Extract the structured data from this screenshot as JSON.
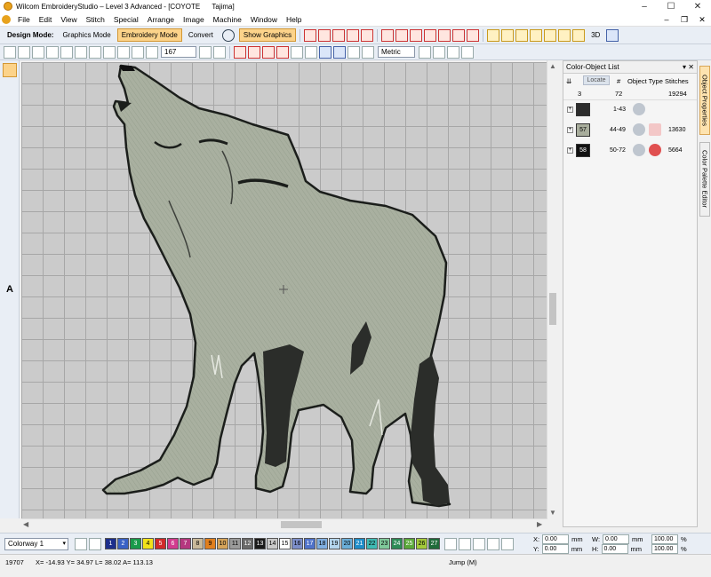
{
  "window": {
    "title": "Wilcom EmbroideryStudio – Level 3 Advanced - [COYOTE      Tajima]",
    "minimize": "–",
    "maximize": "☐",
    "close": "✕"
  },
  "menu": [
    "File",
    "Edit",
    "View",
    "Stitch",
    "Special",
    "Arrange",
    "Image",
    "Machine",
    "Window",
    "Help"
  ],
  "mdi_controls": [
    "–",
    "❐",
    "✕"
  ],
  "toolbar": {
    "design_mode_label": "Design Mode:",
    "graphics_mode": "Graphics Mode",
    "embroidery_mode": "Embroidery Mode",
    "convert": "Convert",
    "show_graphics": "Show Graphics",
    "view_3d": "3D"
  },
  "toolbar2": {
    "zoom": "167",
    "units": "Metric"
  },
  "panel": {
    "title": "Color-Object List",
    "controls": "▾ ✕",
    "locate": "Locate",
    "col_hash": "#",
    "col_object_type": "Object Type",
    "col_stitches": "Stitches",
    "summary": {
      "count": "3",
      "range": "72",
      "stitches": "19294"
    },
    "rows": [
      {
        "color": "",
        "range": "1-43",
        "stitches": "",
        "swatch_color": "#2d2d2d"
      },
      {
        "color": "57",
        "range": "44-49",
        "stitches": "13630",
        "swatch_color": "#a8ad9c"
      },
      {
        "color": "58",
        "range": "50-72",
        "stitches": "5664",
        "swatch_color": "#111111"
      }
    ]
  },
  "side_tabs": [
    "Object Properties",
    "Color Palette Editor"
  ],
  "colorway": "Colorway 1",
  "color_chips": [
    {
      "n": "1",
      "c": "#1c2f8c",
      "t": "#fff"
    },
    {
      "n": "2",
      "c": "#3a62c5",
      "t": "#fff"
    },
    {
      "n": "3",
      "c": "#1a9a4a",
      "t": "#fff"
    },
    {
      "n": "4",
      "c": "#f2e21a",
      "t": "#000"
    },
    {
      "n": "5",
      "c": "#d12a2a",
      "t": "#fff"
    },
    {
      "n": "6",
      "c": "#d23c8f",
      "t": "#fff"
    },
    {
      "n": "7",
      "c": "#b5377f",
      "t": "#fff"
    },
    {
      "n": "8",
      "c": "#c9b99a",
      "t": "#000"
    },
    {
      "n": "9",
      "c": "#e07f1d",
      "t": "#000"
    },
    {
      "n": "10",
      "c": "#d4a35a",
      "t": "#000"
    },
    {
      "n": "11",
      "c": "#9a9a9a",
      "t": "#000"
    },
    {
      "n": "12",
      "c": "#6a6a6a",
      "t": "#fff"
    },
    {
      "n": "13",
      "c": "#1a1a1a",
      "t": "#fff"
    },
    {
      "n": "14",
      "c": "#c9c9c9",
      "t": "#000"
    },
    {
      "n": "15",
      "c": "#ffffff",
      "t": "#000"
    },
    {
      "n": "16",
      "c": "#7c8ec9",
      "t": "#000"
    },
    {
      "n": "17",
      "c": "#4f72c9",
      "t": "#fff"
    },
    {
      "n": "18",
      "c": "#7faee0",
      "t": "#000"
    },
    {
      "n": "19",
      "c": "#b4d6ee",
      "t": "#000"
    },
    {
      "n": "20",
      "c": "#6aaed8",
      "t": "#000"
    },
    {
      "n": "21",
      "c": "#1e8cc8",
      "t": "#fff"
    },
    {
      "n": "22",
      "c": "#3fb9b3",
      "t": "#000"
    },
    {
      "n": "23",
      "c": "#7fc99a",
      "t": "#000"
    },
    {
      "n": "24",
      "c": "#2e8b57",
      "t": "#fff"
    },
    {
      "n": "25",
      "c": "#5aa83a",
      "t": "#fff"
    },
    {
      "n": "26",
      "c": "#a3c93a",
      "t": "#000"
    },
    {
      "n": "27",
      "c": "#1f6b3a",
      "t": "#fff"
    }
  ],
  "position": {
    "x_label": "X:",
    "x": "0.00",
    "x_unit": "mm",
    "y_label": "Y:",
    "y": "0.00",
    "y_unit": "mm",
    "w_label": "W:",
    "w": "0.00",
    "w_unit": "mm",
    "h_label": "H:",
    "h": "0.00",
    "h_unit": "mm",
    "sx": "100.00",
    "sy": "100.00",
    "pct": "%"
  },
  "status": {
    "stitch_count": "19707",
    "coords": "X= -14.93 Y= 34.97 L= 38.02 A= 113.13",
    "mode": "Jump (M)"
  },
  "colors": {
    "wolf_body": "#a9b0a0",
    "wolf_outline": "#1b1e1b",
    "wolf_dark": "#2b2d2a",
    "canvas": "#cbcbcb",
    "accent": "#fcd38a"
  }
}
